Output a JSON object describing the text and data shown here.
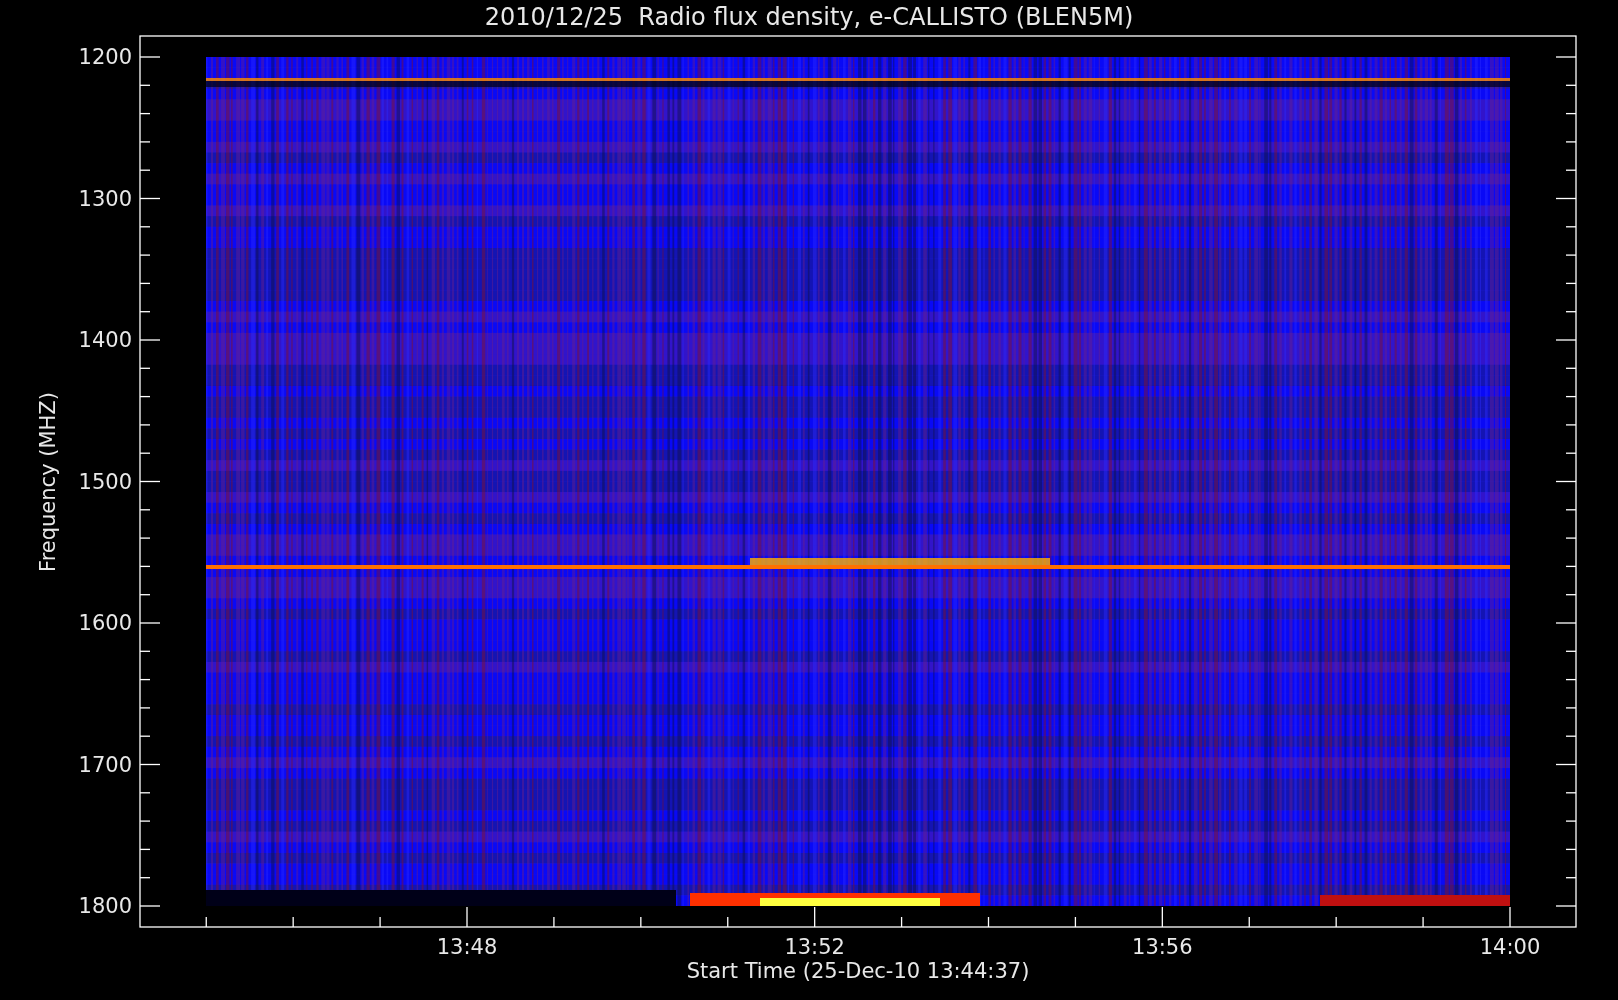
{
  "title": "2010/12/25  Radio flux density, e-CALLISTO (BLEN5M)",
  "y_axis": {
    "label": "Frequency (MHZ)",
    "ticks": [
      "1200",
      "1300",
      "1400",
      "1500",
      "1600",
      "1700",
      "1800"
    ]
  },
  "x_axis": {
    "label": "Start Time (25-Dec-10 13:44:37)",
    "ticks": [
      "13:48",
      "13:52",
      "13:56",
      "14:00"
    ]
  }
}
